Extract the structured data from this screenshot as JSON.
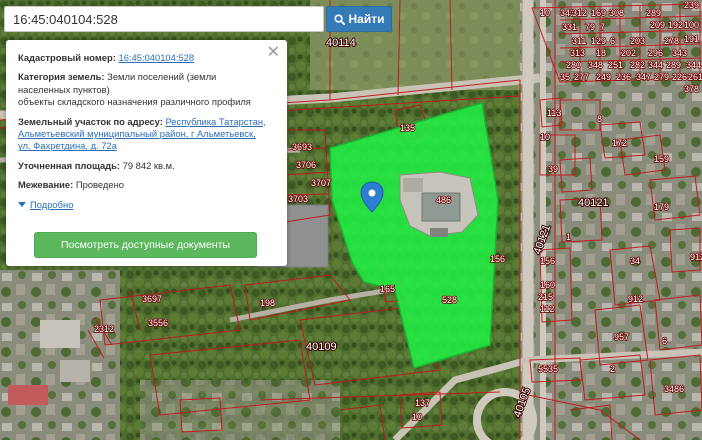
{
  "search": {
    "value": "16:45:040104:528",
    "button_label": "Найти",
    "button_icon": "search-icon"
  },
  "info_card": {
    "close_icon": "close-icon",
    "cadastral_number": {
      "label": "Кадастровый номер:",
      "value": "16:45:040104:528"
    },
    "land_category": {
      "label": "Категория земель:",
      "value_line1": "Земли поселений (земли",
      "value_line2": "населенных пунктов)",
      "value_line3": "объекты складского назначения различного профиля"
    },
    "address": {
      "label": "Земельный участок по адресу:",
      "value_part1": "Республика Татарстан,",
      "value_part2": "Альметьевский муниципальный район, г Альметьевск,",
      "value_part3": "ул. Фахретдина, д. 72а"
    },
    "area": {
      "label": "Уточненная площадь:",
      "value": "79 842 кв.м."
    },
    "survey": {
      "label": "Межевание:",
      "value": "Проведено"
    },
    "more_link": "Подробно",
    "docs_button": "Посмотреть доступные документы"
  },
  "map": {
    "highlight_color": "#22ee44",
    "boundary_color": "#c4151c",
    "marker_icon": "map-pin-icon",
    "quarter_labels": [
      "40114",
      "40121",
      "40109",
      "40105"
    ],
    "parcel_labels": [
      "343",
      "312",
      "169",
      "308",
      "289",
      "239",
      "10",
      "331",
      "79",
      "7",
      "209",
      "192",
      "100",
      "311",
      "129",
      "6",
      "203",
      "278",
      "191",
      "313",
      "18",
      "202",
      "296",
      "343",
      "280",
      "348",
      "251",
      "282",
      "344",
      "289",
      "344",
      "35",
      "277",
      "249",
      "236",
      "347",
      "279",
      "226",
      "261",
      "378",
      "135",
      "113",
      "3693",
      "3706",
      "3707",
      "3703",
      "486",
      "156",
      "165",
      "528",
      "198",
      "3697",
      "3556",
      "2312",
      "156",
      "160",
      "215",
      "112",
      "172",
      "8",
      "159",
      "1",
      "39",
      "179",
      "34",
      "912",
      "957",
      "2",
      "5535",
      "3486",
      "137",
      "10",
      "912",
      "6",
      "10"
    ]
  }
}
